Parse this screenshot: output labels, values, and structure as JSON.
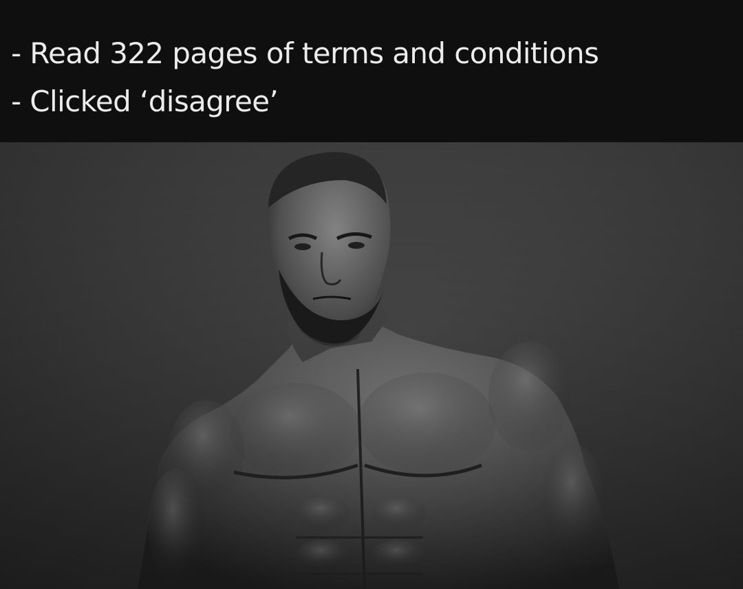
{
  "caption": {
    "lines": [
      "- Read 322 pages of terms and conditions",
      "- Clicked ‘disagree’"
    ]
  },
  "photo": {
    "subject": "muscular-bearded-man",
    "style": "grayscale"
  },
  "colors": {
    "caption_background": "#0f0f0f",
    "caption_text": "#ececec",
    "photo_background": "#3c3c3c"
  }
}
